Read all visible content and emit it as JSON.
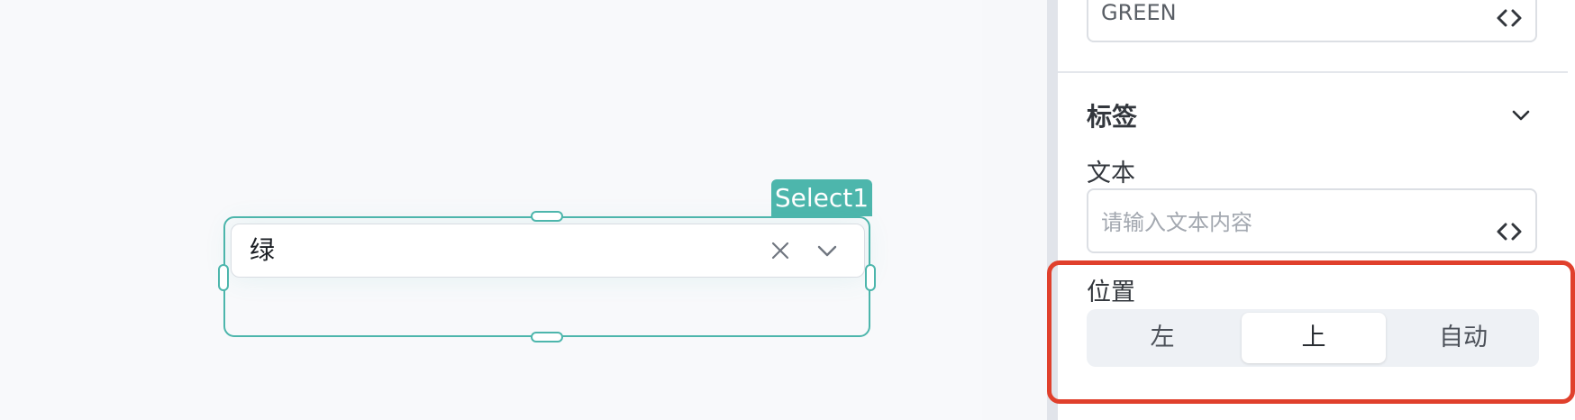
{
  "canvas": {
    "component_tag": "Select1",
    "select": {
      "value": "绿"
    }
  },
  "panel": {
    "top_field": {
      "value": "GREEN"
    },
    "label_section": {
      "title": "标签",
      "text_label": "文本",
      "text_placeholder": "请输入文本内容",
      "position_label": "位置",
      "position_options": [
        "左",
        "上",
        "自动"
      ],
      "position_selected": "上"
    }
  },
  "colors": {
    "accent": "#4db6ac",
    "highlight": "#e0402c"
  },
  "icons": [
    "close-icon",
    "chevron-down-icon",
    "code-icon"
  ]
}
